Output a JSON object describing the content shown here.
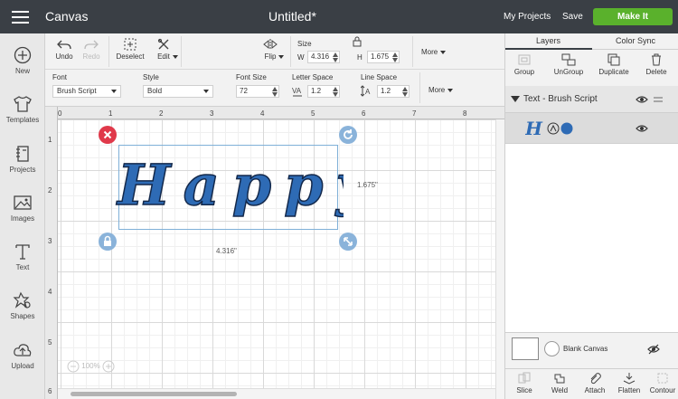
{
  "topbar": {
    "app_title": "Canvas",
    "doc_title": "Untitled*",
    "my_projects": "My Projects",
    "save": "Save",
    "make_it": "Make It"
  },
  "sidebar": {
    "items": [
      {
        "label": "New",
        "icon": "plus-circle-icon"
      },
      {
        "label": "Templates",
        "icon": "tshirt-icon"
      },
      {
        "label": "Projects",
        "icon": "notebook-icon"
      },
      {
        "label": "Images",
        "icon": "image-icon"
      },
      {
        "label": "Text",
        "icon": "text-icon"
      },
      {
        "label": "Shapes",
        "icon": "shapes-icon"
      },
      {
        "label": "Upload",
        "icon": "cloud-upload-icon"
      }
    ]
  },
  "toolbar1": {
    "undo": "Undo",
    "redo": "Redo",
    "deselect": "Deselect",
    "edit": "Edit",
    "flip": "Flip",
    "size_label": "Size",
    "w_label": "W",
    "w_value": "4.316",
    "h_label": "H",
    "h_value": "1.675",
    "more": "More"
  },
  "toolbar2": {
    "font_label": "Font",
    "font_value": "Brush Script",
    "style_label": "Style",
    "style_value": "Bold",
    "font_size_label": "Font Size",
    "font_size_value": "72",
    "letter_space_label": "Letter Space",
    "letter_space_value": "1.2",
    "line_space_label": "Line Space",
    "line_space_value": "1.2",
    "more": "More"
  },
  "canvas": {
    "ruler_top": [
      "0",
      "1",
      "2",
      "3",
      "4",
      "5",
      "6",
      "7",
      "8"
    ],
    "ruler_left": [
      "1",
      "2",
      "3",
      "4",
      "5",
      "6"
    ],
    "text": "Happy",
    "height_dim": "1.675\"",
    "width_dim": "4.316\"",
    "zoom": "100%",
    "colors": {
      "text_fill": "#2e6bb5",
      "delete_handle": "#e0394a",
      "handle": "#8ab3da"
    }
  },
  "rpanel": {
    "tab_layers": "Layers",
    "tab_color_sync": "Color Sync",
    "actions": [
      "Group",
      "UnGroup",
      "Duplicate",
      "Delete"
    ],
    "layer_name": "Text - Brush Script",
    "blank_canvas": "Blank Canvas",
    "bottom_actions": [
      "Slice",
      "Weld",
      "Attach",
      "Flatten",
      "Contour"
    ]
  }
}
